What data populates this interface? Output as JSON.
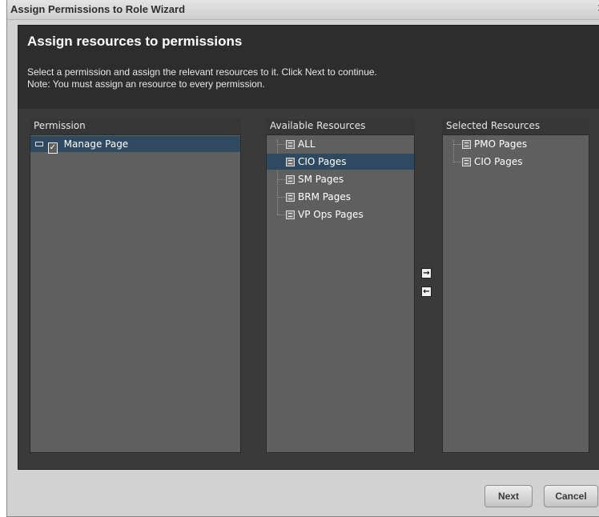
{
  "window": {
    "title": "Assign Permissions to Role Wizard",
    "close_glyph": "×"
  },
  "header": {
    "heading": "Assign resources to permissions",
    "description_line1": "Select a permission and assign the relevant resources to it. Click Next to continue.",
    "description_line2": "Note: You must assign an resource to every permission."
  },
  "permissions": {
    "header": "Permission",
    "items": [
      {
        "label": "Manage Page",
        "icon": "document-check-icon",
        "selected": true
      }
    ]
  },
  "available": {
    "header": "Available Resources",
    "items": [
      {
        "label": "ALL",
        "icon": "resource-icon",
        "selected": false
      },
      {
        "label": "CIO Pages",
        "icon": "resource-icon",
        "selected": true
      },
      {
        "label": "SM Pages",
        "icon": "resource-icon",
        "selected": false
      },
      {
        "label": "BRM Pages",
        "icon": "resource-icon",
        "selected": false
      },
      {
        "label": "VP Ops Pages",
        "icon": "resource-icon",
        "selected": false
      }
    ]
  },
  "selected": {
    "header": "Selected Resources",
    "items": [
      {
        "label": "PMO Pages",
        "icon": "resource-icon"
      },
      {
        "label": "CIO Pages",
        "icon": "resource-icon"
      }
    ]
  },
  "transfer": {
    "add_glyph": "→",
    "remove_glyph": "←"
  },
  "footer": {
    "next_label": "Next",
    "cancel_label": "Cancel"
  },
  "colors": {
    "panel_bg": "#3a3a3a",
    "list_bg": "#5f5f5f",
    "selection": "#2f4a60"
  }
}
